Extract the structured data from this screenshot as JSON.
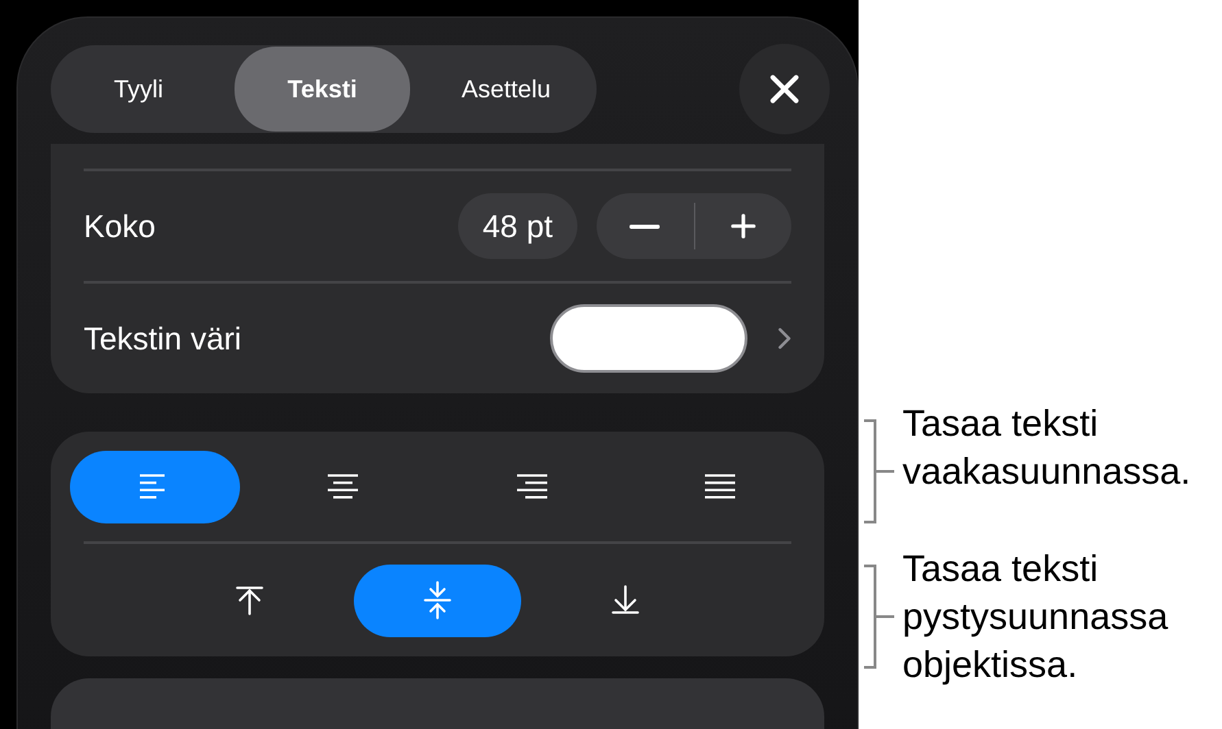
{
  "tabs": [
    {
      "label": "Tyyli",
      "selected": false
    },
    {
      "label": "Teksti",
      "selected": true
    },
    {
      "label": "Asettelu",
      "selected": false
    }
  ],
  "size": {
    "label": "Koko",
    "value": "48 pt"
  },
  "text_color": {
    "label": "Tekstin väri",
    "color": "#ffffff"
  },
  "horizontal_alignment": [
    {
      "kind": "left",
      "selected": true
    },
    {
      "kind": "center",
      "selected": false
    },
    {
      "kind": "right",
      "selected": false
    },
    {
      "kind": "justify",
      "selected": false
    }
  ],
  "vertical_alignment": [
    {
      "kind": "top",
      "selected": false
    },
    {
      "kind": "middle",
      "selected": true
    },
    {
      "kind": "bottom",
      "selected": false
    }
  ],
  "callouts": [
    "Tasaa teksti vaakasuunnassa.",
    "Tasaa teksti pystysuunnassa objektissa."
  ]
}
